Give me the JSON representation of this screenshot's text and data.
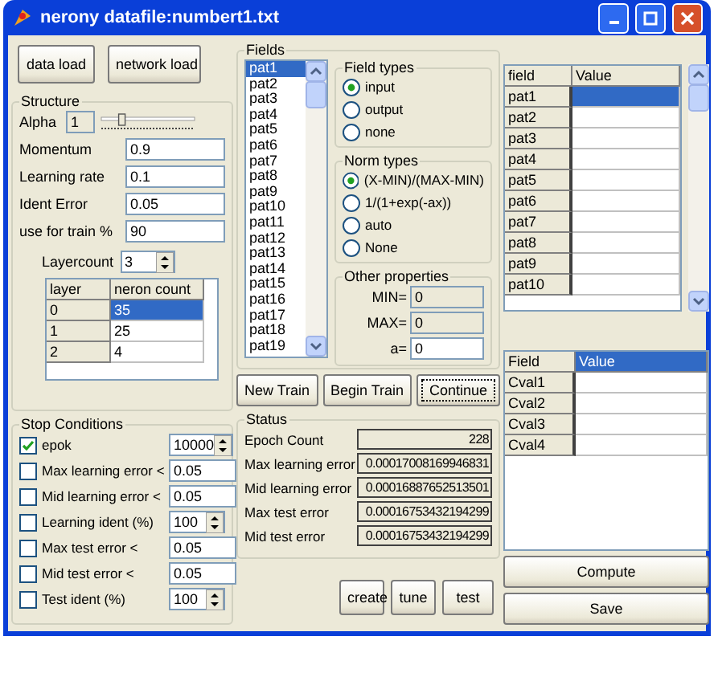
{
  "window": {
    "title": "nerony datafile:numbert1.txt"
  },
  "top_buttons": [
    "data load",
    "network load"
  ],
  "structure": {
    "title": "Structure",
    "alpha": {
      "label": "Alpha",
      "value": "1",
      "level": 0.2
    },
    "params": [
      {
        "label": "Momentum",
        "value": "0.9"
      },
      {
        "label": "Learning rate",
        "value": "0.1"
      },
      {
        "label": "Ident Error",
        "value": "0.05"
      },
      {
        "label": "use for train %",
        "value": "90"
      }
    ],
    "layercount": {
      "label": "Layercount",
      "value": "3"
    },
    "layer_table": {
      "columns": [
        "layer",
        "neron count"
      ],
      "rows": [
        {
          "cells": [
            "0",
            "35"
          ],
          "selected": true
        },
        {
          "cells": [
            "1",
            "25"
          ],
          "selected": false
        },
        {
          "cells": [
            "2",
            "4"
          ],
          "selected": false
        }
      ]
    }
  },
  "stop_conditions": {
    "title": "Stop Conditions",
    "rows": [
      {
        "label": "epok",
        "checked": true,
        "value": "10000",
        "kind": "spin"
      },
      {
        "label": "Max learning error <",
        "checked": false,
        "value": "0.05",
        "kind": "text"
      },
      {
        "label": "Mid learning error <",
        "checked": false,
        "value": "0.05",
        "kind": "text"
      },
      {
        "label": "Learning ident (%)",
        "checked": false,
        "value": "100",
        "kind": "spin"
      },
      {
        "label": "Max test error <",
        "checked": false,
        "value": "0.05",
        "kind": "text"
      },
      {
        "label": "Mid test error <",
        "checked": false,
        "value": "0.05",
        "kind": "text"
      },
      {
        "label": "Test ident  (%)",
        "checked": false,
        "value": "100",
        "kind": "spin"
      }
    ]
  },
  "fields": {
    "title": "Fields",
    "items": [
      {
        "label": "pat1",
        "selected": true
      },
      {
        "label": "pat2",
        "selected": false
      },
      {
        "label": "pat3",
        "selected": false
      },
      {
        "label": "pat4",
        "selected": false
      },
      {
        "label": "pat5",
        "selected": false
      },
      {
        "label": "pat6",
        "selected": false
      },
      {
        "label": "pat7",
        "selected": false
      },
      {
        "label": "pat8",
        "selected": false
      },
      {
        "label": "pat9",
        "selected": false
      },
      {
        "label": "pat10",
        "selected": false
      },
      {
        "label": "pat11",
        "selected": false
      },
      {
        "label": "pat12",
        "selected": false
      },
      {
        "label": "pat13",
        "selected": false
      },
      {
        "label": "pat14",
        "selected": false
      },
      {
        "label": "pat15",
        "selected": false
      },
      {
        "label": "pat16",
        "selected": false
      },
      {
        "label": "pat17",
        "selected": false
      },
      {
        "label": "pat18",
        "selected": false
      },
      {
        "label": "pat19",
        "selected": false
      }
    ],
    "field_types": {
      "title": "Field types",
      "options": [
        {
          "label": "input",
          "selected": true
        },
        {
          "label": "output",
          "selected": false
        },
        {
          "label": "none",
          "selected": false
        }
      ]
    },
    "norm_types": {
      "title": "Norm types",
      "options": [
        {
          "label": "(X-MIN)/(MAX-MIN)",
          "selected": true
        },
        {
          "label": "1/(1+exp(-ax))",
          "selected": false
        },
        {
          "label": "auto",
          "selected": false
        },
        {
          "label": "None",
          "selected": false
        }
      ]
    },
    "other_properties": {
      "title": "Other properties",
      "fields": [
        {
          "label": "MIN=",
          "value": "0",
          "disabled": true
        },
        {
          "label": "MAX=",
          "value": "0",
          "disabled": true
        },
        {
          "label": "a=",
          "value": "0",
          "disabled": false
        }
      ]
    }
  },
  "train_buttons": [
    {
      "label": "New Train",
      "focused": false
    },
    {
      "label": "Begin Train",
      "focused": false
    },
    {
      "label": "Continue",
      "focused": true
    }
  ],
  "status": {
    "title": "Status",
    "rows": [
      {
        "label": "Epoch Count",
        "value": "228"
      },
      {
        "label": "Max learning error",
        "value": "0.00017008169946831"
      },
      {
        "label": "Mid learning error",
        "value": "0.00016887652513501"
      },
      {
        "label": "Max test error",
        "value": "0.00016753432194299"
      },
      {
        "label": "Mid test error",
        "value": "0.00016753432194299"
      }
    ]
  },
  "action_buttons": [
    "create",
    "tune",
    "test"
  ],
  "field_grid": {
    "columns": [
      {
        "label": "field",
        "selected": false
      },
      {
        "label": "Value",
        "selected": false
      }
    ],
    "rows": [
      {
        "field": "pat1",
        "selected": true
      },
      {
        "field": "pat2",
        "selected": false
      },
      {
        "field": "pat3",
        "selected": false
      },
      {
        "field": "pat4",
        "selected": false
      },
      {
        "field": "pat5",
        "selected": false
      },
      {
        "field": "pat6",
        "selected": false
      },
      {
        "field": "pat7",
        "selected": false
      },
      {
        "field": "pat8",
        "selected": false
      },
      {
        "field": "pat9",
        "selected": false
      },
      {
        "field": "pat10",
        "selected": false
      }
    ]
  },
  "compute_grid": {
    "columns": [
      {
        "label": "Field",
        "selected": false
      },
      {
        "label": "Value",
        "selected": true
      }
    ],
    "rows": [
      {
        "field": "Cval1",
        "selected": false
      },
      {
        "field": "Cval2",
        "selected": false
      },
      {
        "field": "Cval3",
        "selected": false
      },
      {
        "field": "Cval4",
        "selected": false
      }
    ]
  },
  "bottom_buttons": [
    "Compute",
    "Save"
  ]
}
